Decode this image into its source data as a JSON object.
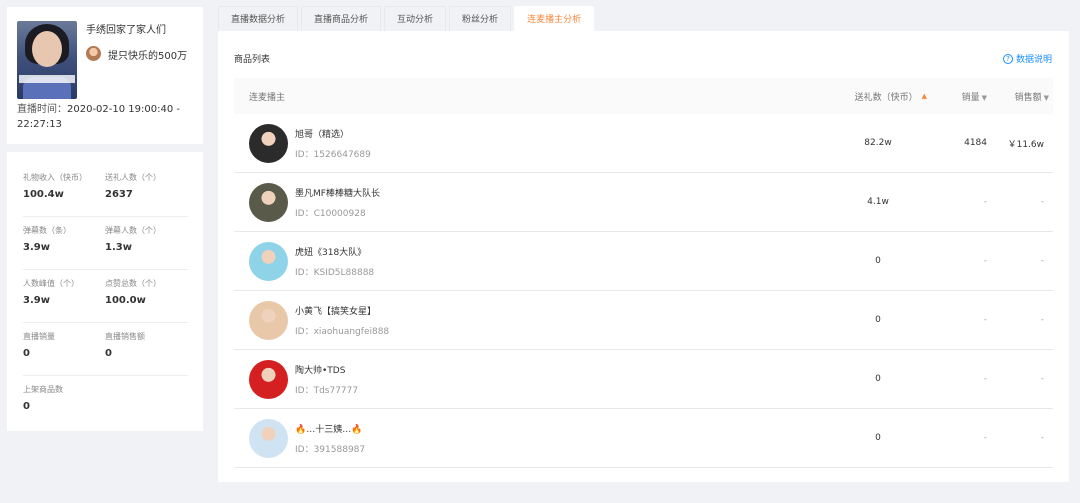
{
  "profile": {
    "name": "手绣回家了家人们",
    "topic": "提只快乐的500万",
    "live_time_label": "直播时间：",
    "live_time_value": "2020-02-10 19:00:40 - 22:27:13"
  },
  "stats": [
    [
      {
        "label": "礼物收入（快币）",
        "value": "100.4w"
      },
      {
        "label": "送礼人数（个）",
        "value": "2637"
      }
    ],
    [
      {
        "label": "弹幕数（条）",
        "value": "3.9w"
      },
      {
        "label": "弹幕人数（个）",
        "value": "1.3w"
      }
    ],
    [
      {
        "label": "人数峰值（个）",
        "value": "3.9w"
      },
      {
        "label": "点赞总数（个）",
        "value": "100.0w"
      }
    ],
    [
      {
        "label": "直播销量",
        "value": "0"
      },
      {
        "label": "直播销售额",
        "value": "0"
      }
    ],
    [
      {
        "label": "上架商品数",
        "value": "0"
      }
    ]
  ],
  "tabs": [
    {
      "label": "直播数据分析",
      "active": false
    },
    {
      "label": "直播商品分析",
      "active": false
    },
    {
      "label": "互动分析",
      "active": false
    },
    {
      "label": "粉丝分析",
      "active": false
    },
    {
      "label": "连麦播主分析",
      "active": true
    }
  ],
  "list_title": "商品列表",
  "help_label": "数据说明",
  "table": {
    "headers": {
      "host": "连麦播主",
      "gift": "送礼数（快币）",
      "sales": "销量",
      "amount": "销售额"
    },
    "rows": [
      {
        "name": "旭哥（精选）",
        "id": "ID：1526647689",
        "gift": "82.2w",
        "sales": "4184",
        "amount": "￥11.6w",
        "avatar_color": "#2b2b2b"
      },
      {
        "name": "墨凡MF棒棒糖大队长",
        "id": "ID：C10000928",
        "gift": "4.1w",
        "sales": "-",
        "amount": "-",
        "avatar_color": "#5a5a4a"
      },
      {
        "name": "虎妞《318大队》",
        "id": "ID：KSID5L88888",
        "gift": "0",
        "sales": "-",
        "amount": "-",
        "avatar_color": "#8fd3e8"
      },
      {
        "name": "小黄飞【搞笑女星】",
        "id": "ID：xiaohuangfei888",
        "gift": "0",
        "sales": "-",
        "amount": "-",
        "avatar_color": "#e8c8a8"
      },
      {
        "name": "陶大帅•TDS",
        "id": "ID：Tds77777",
        "gift": "0",
        "sales": "-",
        "amount": "-",
        "avatar_color": "#d42020"
      },
      {
        "name": "🔥…十三姨…🔥",
        "id": "ID：391588987",
        "gift": "0",
        "sales": "-",
        "amount": "-",
        "avatar_color": "#cfe3f3"
      }
    ]
  }
}
